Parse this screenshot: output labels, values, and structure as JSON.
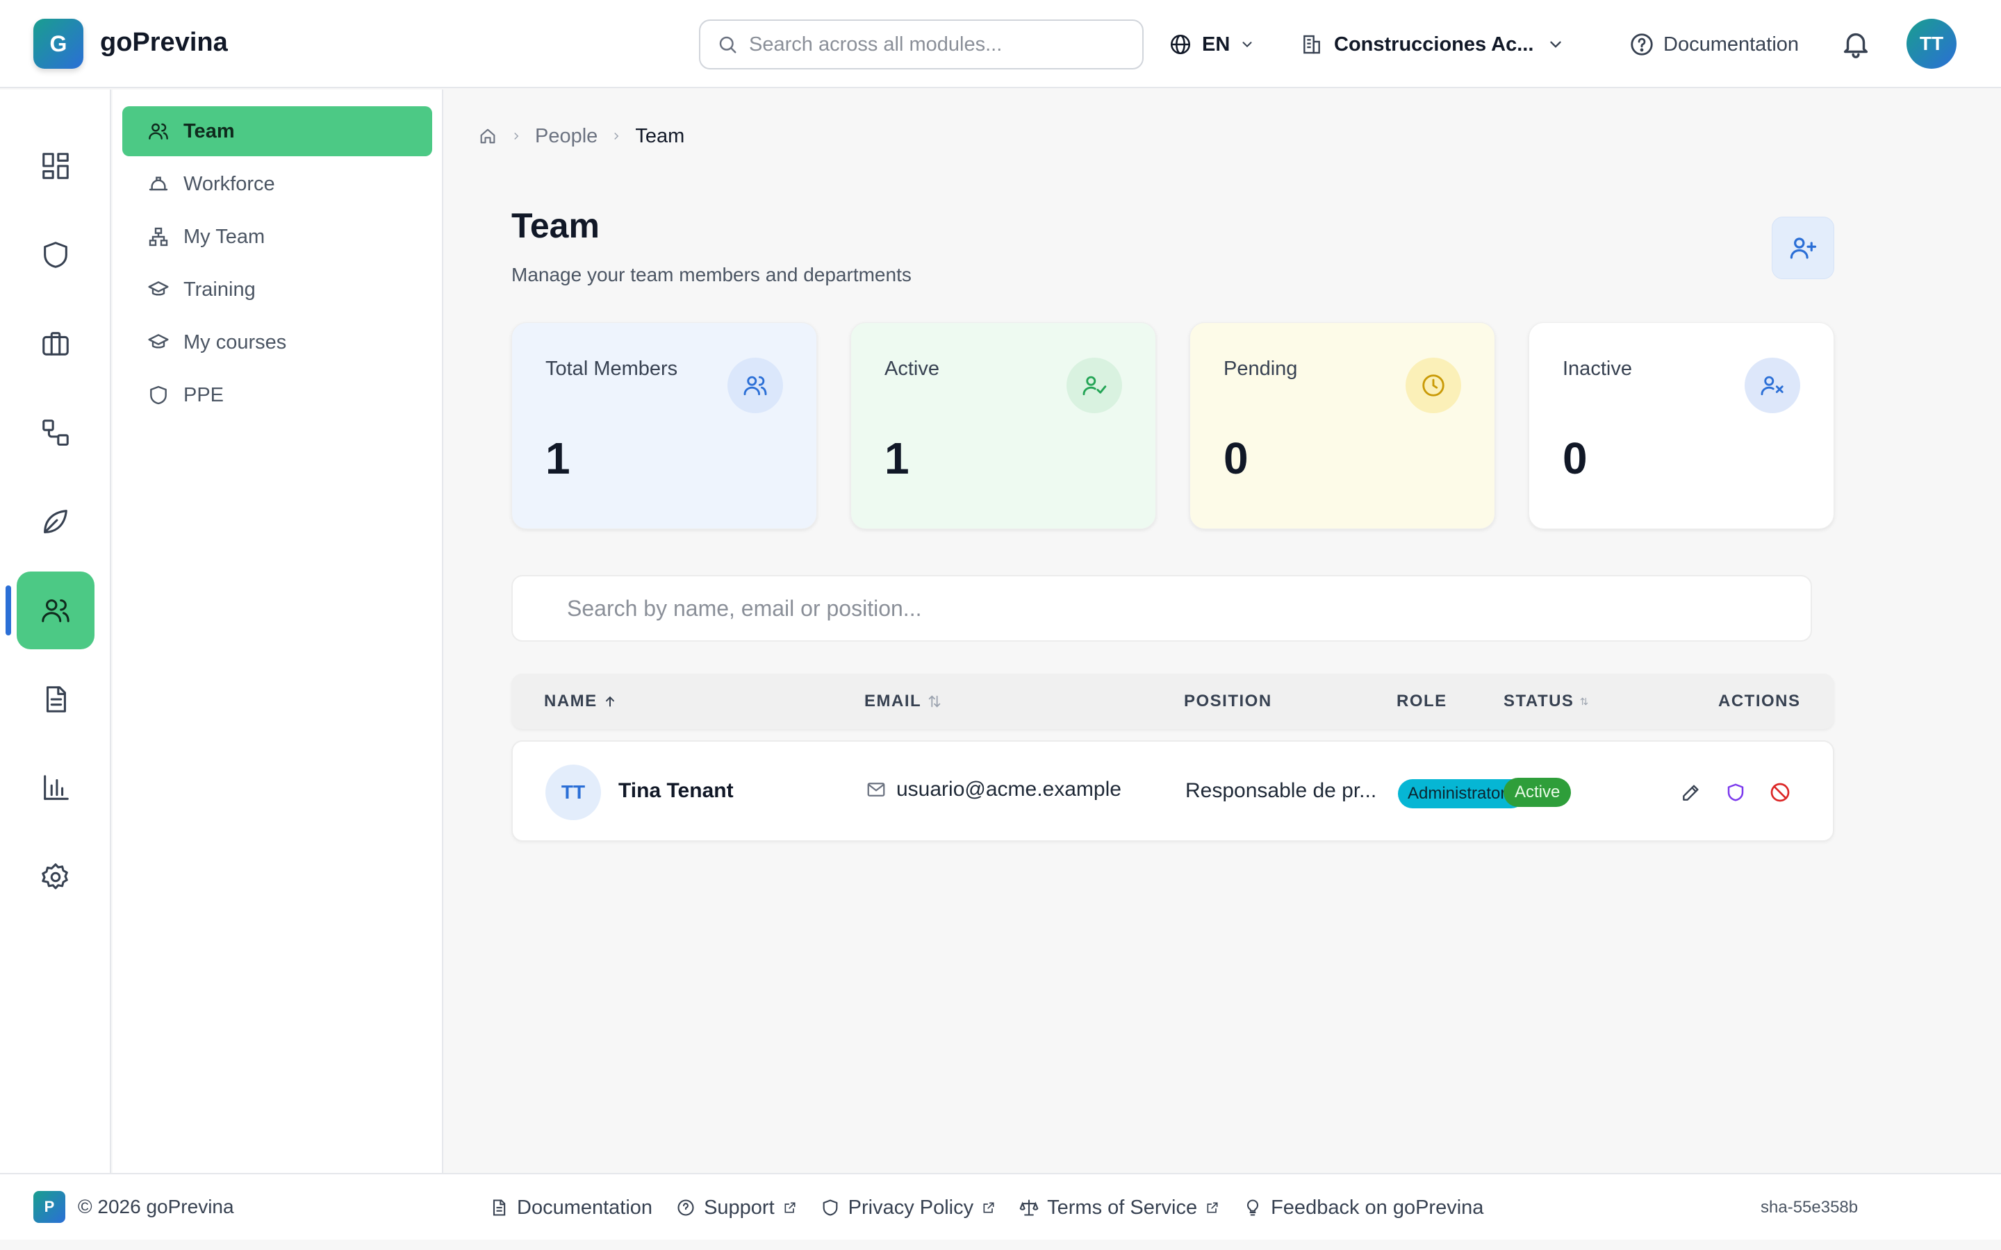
{
  "app": {
    "logo_letter": "G",
    "name": "goPrevina"
  },
  "header": {
    "search_placeholder": "Search across all modules...",
    "language": "EN",
    "company": "Construcciones Ac...",
    "documentation": "Documentation",
    "user_initials": "TT"
  },
  "rail": {
    "items": [
      "dashboard-icon",
      "shield-icon",
      "briefcase-icon",
      "workflow-icon",
      "leaf-icon",
      "users-icon",
      "document-icon",
      "bar-chart-icon",
      "settings-icon"
    ],
    "active_index": 5,
    "active_color": "#4cc985"
  },
  "subnav": {
    "items": [
      {
        "label": "Team",
        "icon": "users-icon",
        "active": true
      },
      {
        "label": "Workforce",
        "icon": "hard-hat-icon",
        "active": false
      },
      {
        "label": "My Team",
        "icon": "org-chart-icon",
        "active": false
      },
      {
        "label": "Training",
        "icon": "graduation-cap-icon",
        "active": false
      },
      {
        "label": "My courses",
        "icon": "graduation-cap-icon",
        "active": false
      },
      {
        "label": "PPE",
        "icon": "shield-icon",
        "active": false
      }
    ]
  },
  "breadcrumb": {
    "items": [
      "People",
      "Team"
    ]
  },
  "page": {
    "title": "Team",
    "subtitle": "Manage your team members and departments"
  },
  "stats": [
    {
      "label": "Total Members",
      "value": "1",
      "bg": "#eef4fd",
      "icon_bg": "#dbe7fb",
      "icon_color": "#2b6fd6",
      "icon": "users-icon"
    },
    {
      "label": "Active",
      "value": "1",
      "bg": "#eefaf1",
      "icon_bg": "#d9f2e0",
      "icon_color": "#23a455",
      "icon": "user-check-icon"
    },
    {
      "label": "Pending",
      "value": "0",
      "bg": "#fdfbe8",
      "icon_bg": "#fbf0b8",
      "icon_color": "#c99a06",
      "icon": "clock-icon"
    },
    {
      "label": "Inactive",
      "value": "0",
      "bg": "#ffffff",
      "icon_bg": "#dde7fa",
      "icon_color": "#2b6fd6",
      "icon": "user-x-icon"
    }
  ],
  "member_search": {
    "placeholder": "Search by name, email or position..."
  },
  "table": {
    "headers": {
      "name": "NAME",
      "email": "EMAIL",
      "position": "POSITION",
      "role": "ROLE",
      "status": "STATUS",
      "actions": "ACTIONS"
    },
    "rows": [
      {
        "initials": "TT",
        "name": "Tina Tenant",
        "email": "usuario@acme.example",
        "position": "Responsable de pr...",
        "role": "Administrator",
        "status": "Active"
      }
    ]
  },
  "footer": {
    "logo_letter": "P",
    "copyright": "© 2026 goPrevina",
    "links": {
      "documentation": "Documentation",
      "support": "Support",
      "privacy": "Privacy Policy",
      "terms": "Terms of Service",
      "feedback": "Feedback on goPrevina"
    },
    "build": "sha-55e358b"
  }
}
